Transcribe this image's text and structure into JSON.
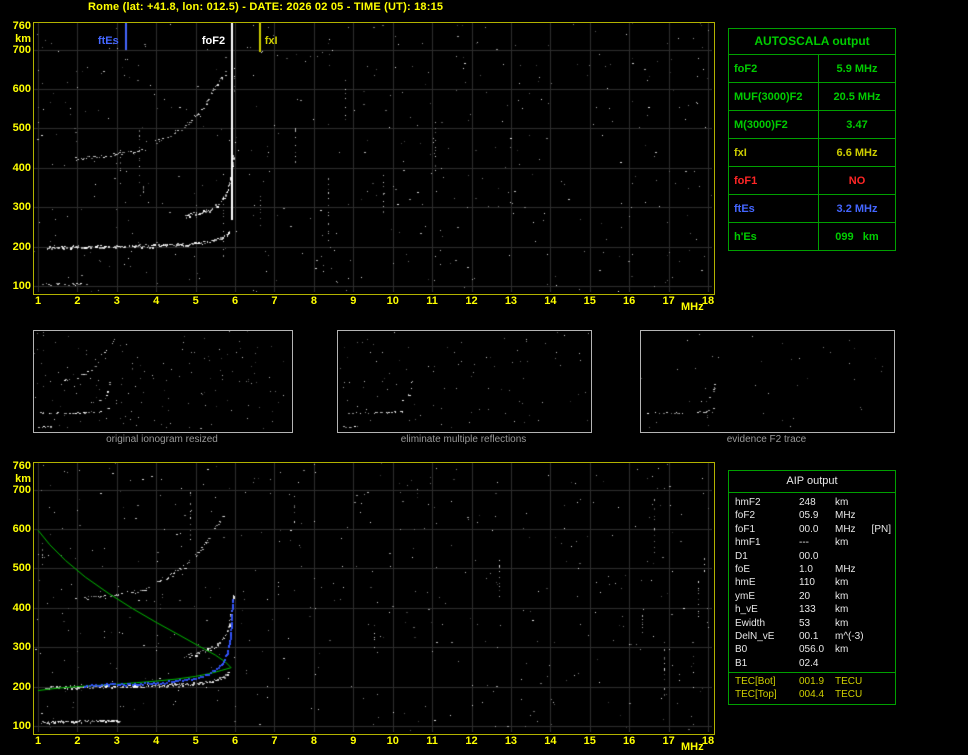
{
  "title": "Rome (lat: +41.8, lon: 012.5) - DATE: 2026 02 05 - TIME (UT): 18:15",
  "colors": {
    "background": "#000000",
    "axis_text": "#ffff00",
    "plot_border": "#b2b200",
    "grid": "#2e2e2e",
    "echo": "#ffffff",
    "profile_green": "#00bb00",
    "restored_blue": "#3355ff",
    "table_border": "#00a000",
    "green_text": "#00cc00",
    "yellow_text": "#cccc00",
    "red_text": "#ff2626",
    "blue_text": "#4466ff",
    "white_text": "#e8e8e8",
    "caption_text": "#9a9a9a"
  },
  "autoscala": {
    "title": "AUTOSCALA output",
    "rows": [
      {
        "label": "foF2",
        "value": "5.9 MHz",
        "color": "#00cc00"
      },
      {
        "label": "MUF(3000)F2",
        "value": "20.5 MHz",
        "color": "#00cc00"
      },
      {
        "label": "M(3000)F2",
        "value": "3.47",
        "color": "#00cc00"
      },
      {
        "label": "fxI",
        "value": "6.6 MHz",
        "color": "#cccc00"
      },
      {
        "label": "foF1",
        "value": "NO",
        "color": "#ff2626"
      },
      {
        "label": "ftEs",
        "value": "3.2 MHz",
        "color": "#4466ff"
      },
      {
        "label": "h'Es",
        "value": "099   km",
        "color": "#00cc00"
      }
    ]
  },
  "aip": {
    "title": "AIP output",
    "tec_color": "#d0d000",
    "rows": [
      {
        "name": "hmF2",
        "value": "248",
        "unit": "km",
        "note": ""
      },
      {
        "name": "foF2",
        "value": "05.9",
        "unit": "MHz",
        "note": ""
      },
      {
        "name": "foF1",
        "value": "00.0",
        "unit": "MHz",
        "note": "[PN]"
      },
      {
        "name": "hmF1",
        "value": "---",
        "unit": "km",
        "note": ""
      },
      {
        "name": "D1",
        "value": "00.0",
        "unit": "",
        "note": ""
      },
      {
        "name": "foE",
        "value": "1.0",
        "unit": "MHz",
        "note": ""
      },
      {
        "name": "hmE",
        "value": "110",
        "unit": "km",
        "note": ""
      },
      {
        "name": "ymE",
        "value": "20",
        "unit": "km",
        "note": ""
      },
      {
        "name": "h_vE",
        "value": "133",
        "unit": "km",
        "note": ""
      },
      {
        "name": "Ewidth",
        "value": "53",
        "unit": "km",
        "note": ""
      },
      {
        "name": "DelN_vE",
        "value": "00.1",
        "unit": "m^(-3)",
        "note": ""
      },
      {
        "name": "B0",
        "value": "056.0",
        "unit": "km",
        "note": ""
      },
      {
        "name": "B1",
        "value": "02.4",
        "unit": "",
        "note": ""
      }
    ],
    "tec_rows": [
      {
        "name": "TEC[Bot]",
        "value": "001.9",
        "unit": "TECU"
      },
      {
        "name": "TEC[Top]",
        "value": "004.4",
        "unit": "TECU"
      }
    ]
  },
  "thumbnails": [
    {
      "caption": "original ionogram resized",
      "traces": [
        "E-region-echo",
        "Es-trace",
        "F2-trace",
        "Es-second-hop",
        "F2-second-hop"
      ],
      "noise": 150,
      "seed": 31,
      "density_scale": 0.5
    },
    {
      "caption": "eliminate multiple reflections",
      "traces": [
        "E-region-echo",
        "Es-trace",
        "F2-trace"
      ],
      "noise": 90,
      "seed": 37,
      "density_scale": 0.45
    },
    {
      "caption": "evidence F2 trace",
      "traces": [
        "Es-trace",
        "F2-trace"
      ],
      "noise": 40,
      "seed": 41,
      "density_scale": 0.3
    }
  ],
  "chart_data": [
    {
      "id": "ionogram_main",
      "type": "scatter",
      "title": "",
      "xlabel": "MHz",
      "ylabel": "km",
      "xlim": [
        1,
        18
      ],
      "ylim": [
        100,
        760
      ],
      "xticks": [
        1,
        2,
        3,
        4,
        5,
        6,
        7,
        8,
        9,
        10,
        11,
        12,
        13,
        14,
        15,
        16,
        17,
        18
      ],
      "yticks": [
        760,
        700,
        600,
        500,
        400,
        300,
        200,
        100
      ],
      "grid": true,
      "markers": [
        {
          "label": "ftEs",
          "x": 3.2,
          "color": "#4466ff",
          "line_len": 27,
          "label_side": "left"
        },
        {
          "label": "foF2",
          "x": 5.9,
          "color": "#ffffff",
          "line_len": 197,
          "label_side": "left"
        },
        {
          "label": "fxI",
          "x": 6.6,
          "color": "#cccc00",
          "line_len": 29,
          "label_side": "right"
        }
      ],
      "traces": [
        {
          "name": "E-region-echo",
          "color": "#ffffff",
          "width": 1,
          "density": 0.5,
          "jitter": 1.0,
          "points": [
            [
              1.05,
              104
            ],
            [
              1.4,
              105
            ],
            [
              1.9,
              106
            ],
            [
              2.3,
              107
            ]
          ]
        },
        {
          "name": "Es-trace",
          "color": "#ffffff",
          "width": 2,
          "density": 0.85,
          "jitter": 1.4,
          "points": [
            [
              1.2,
              198
            ],
            [
              1.8,
              200
            ],
            [
              2.6,
              201
            ],
            [
              3.4,
              202
            ],
            [
              4.2,
              204
            ],
            [
              4.8,
              207
            ],
            [
              5.3,
              212
            ],
            [
              5.65,
              222
            ],
            [
              5.85,
              238
            ]
          ]
        },
        {
          "name": "F2-trace",
          "color": "#ffffff",
          "width": 2,
          "density": 0.75,
          "jitter": 1.8,
          "points": [
            [
              4.7,
              278
            ],
            [
              5.0,
              284
            ],
            [
              5.3,
              293
            ],
            [
              5.55,
              306
            ],
            [
              5.72,
              325
            ],
            [
              5.83,
              352
            ],
            [
              5.9,
              392
            ],
            [
              5.95,
              432
            ]
          ]
        },
        {
          "name": "Es-second-hop",
          "color": "#e8e8e8",
          "width": 1,
          "density": 0.5,
          "jitter": 1.5,
          "points": [
            [
              1.9,
              424
            ],
            [
              2.4,
              428
            ],
            [
              2.9,
              434
            ],
            [
              3.4,
              441
            ],
            [
              3.8,
              450
            ]
          ]
        },
        {
          "name": "F2-second-hop",
          "color": "#e8e8e8",
          "width": 1,
          "density": 0.55,
          "jitter": 2.0,
          "points": [
            [
              3.9,
              462
            ],
            [
              4.3,
              480
            ],
            [
              4.7,
              505
            ],
            [
              5.0,
              533
            ],
            [
              5.25,
              565
            ],
            [
              5.45,
              600
            ],
            [
              5.75,
              642
            ]
          ]
        }
      ],
      "noise": {
        "seed": 11,
        "count": 430,
        "streaks": 11
      }
    },
    {
      "id": "ionogram_restored",
      "type": "scatter",
      "title": "",
      "xlabel": "MHz",
      "ylabel": "km",
      "xlim": [
        1,
        18
      ],
      "ylim": [
        100,
        760
      ],
      "xticks": [
        1,
        2,
        3,
        4,
        5,
        6,
        7,
        8,
        9,
        10,
        11,
        12,
        13,
        14,
        15,
        16,
        17,
        18
      ],
      "yticks": [
        760,
        700,
        600,
        500,
        400,
        300,
        200,
        100
      ],
      "grid": true,
      "traces": [
        {
          "name": "E-region-echo",
          "color": "#ffffff",
          "width": 2,
          "density": 0.85,
          "jitter": 1.0,
          "points": [
            [
              1.05,
              110
            ],
            [
              1.5,
              112
            ],
            [
              2.1,
              113
            ],
            [
              2.7,
              114
            ],
            [
              3.05,
              114
            ]
          ]
        },
        {
          "name": "Es-trace",
          "color": "#ffffff",
          "width": 2,
          "density": 0.85,
          "jitter": 1.4,
          "points": [
            [
              1.2,
              198
            ],
            [
              1.8,
              200
            ],
            [
              2.6,
              201
            ],
            [
              3.4,
              202
            ],
            [
              4.2,
              204
            ],
            [
              4.8,
              207
            ],
            [
              5.3,
              212
            ],
            [
              5.65,
              222
            ],
            [
              5.85,
              238
            ]
          ]
        },
        {
          "name": "F2-trace",
          "color": "#ffffff",
          "width": 2,
          "density": 0.75,
          "jitter": 1.8,
          "points": [
            [
              4.7,
              278
            ],
            [
              5.0,
              284
            ],
            [
              5.3,
              293
            ],
            [
              5.55,
              306
            ],
            [
              5.72,
              325
            ],
            [
              5.83,
              352
            ],
            [
              5.9,
              392
            ],
            [
              5.95,
              432
            ]
          ]
        },
        {
          "name": "Es-second-hop",
          "color": "#e8e8e8",
          "width": 1,
          "density": 0.5,
          "jitter": 1.5,
          "points": [
            [
              1.9,
              424
            ],
            [
              2.4,
              428
            ],
            [
              2.9,
              434
            ],
            [
              3.4,
              441
            ],
            [
              3.8,
              450
            ]
          ]
        },
        {
          "name": "F2-second-hop",
          "color": "#e8e8e8",
          "width": 1,
          "density": 0.55,
          "jitter": 2.0,
          "points": [
            [
              3.9,
              462
            ],
            [
              4.3,
              480
            ],
            [
              4.7,
              505
            ],
            [
              5.0,
              533
            ],
            [
              5.25,
              565
            ],
            [
              5.45,
              600
            ],
            [
              5.75,
              642
            ]
          ]
        }
      ],
      "profile": {
        "color": "#00bb00",
        "topside": [
          [
            1.0,
            597
          ],
          [
            1.3,
            560
          ],
          [
            1.7,
            520
          ],
          [
            2.2,
            478
          ],
          [
            2.8,
            436
          ],
          [
            3.4,
            398
          ],
          [
            4.0,
            363
          ],
          [
            4.6,
            330
          ],
          [
            5.1,
            302
          ],
          [
            5.5,
            280
          ],
          [
            5.75,
            263
          ],
          [
            5.9,
            248
          ]
        ],
        "bottomside": [
          [
            1.0,
            190
          ],
          [
            1.5,
            196
          ],
          [
            2.0,
            200
          ],
          [
            2.5,
            203
          ],
          [
            3.0,
            206
          ],
          [
            3.5,
            210
          ],
          [
            4.0,
            214
          ],
          [
            4.5,
            219
          ],
          [
            5.0,
            226
          ],
          [
            5.4,
            234
          ],
          [
            5.65,
            241
          ],
          [
            5.9,
            248
          ]
        ]
      },
      "restored_trace": {
        "color": "#3355ff",
        "points": [
          [
            2.2,
            204
          ],
          [
            2.8,
            206
          ],
          [
            3.4,
            208
          ],
          [
            4.0,
            211
          ],
          [
            4.5,
            215
          ],
          [
            4.9,
            221
          ],
          [
            5.25,
            230
          ],
          [
            5.5,
            243
          ],
          [
            5.7,
            262
          ],
          [
            5.82,
            288
          ],
          [
            5.88,
            318
          ],
          [
            5.92,
            360
          ],
          [
            5.95,
            425
          ]
        ]
      },
      "noise": {
        "seed": 23,
        "count": 430,
        "streaks": 11
      }
    }
  ]
}
